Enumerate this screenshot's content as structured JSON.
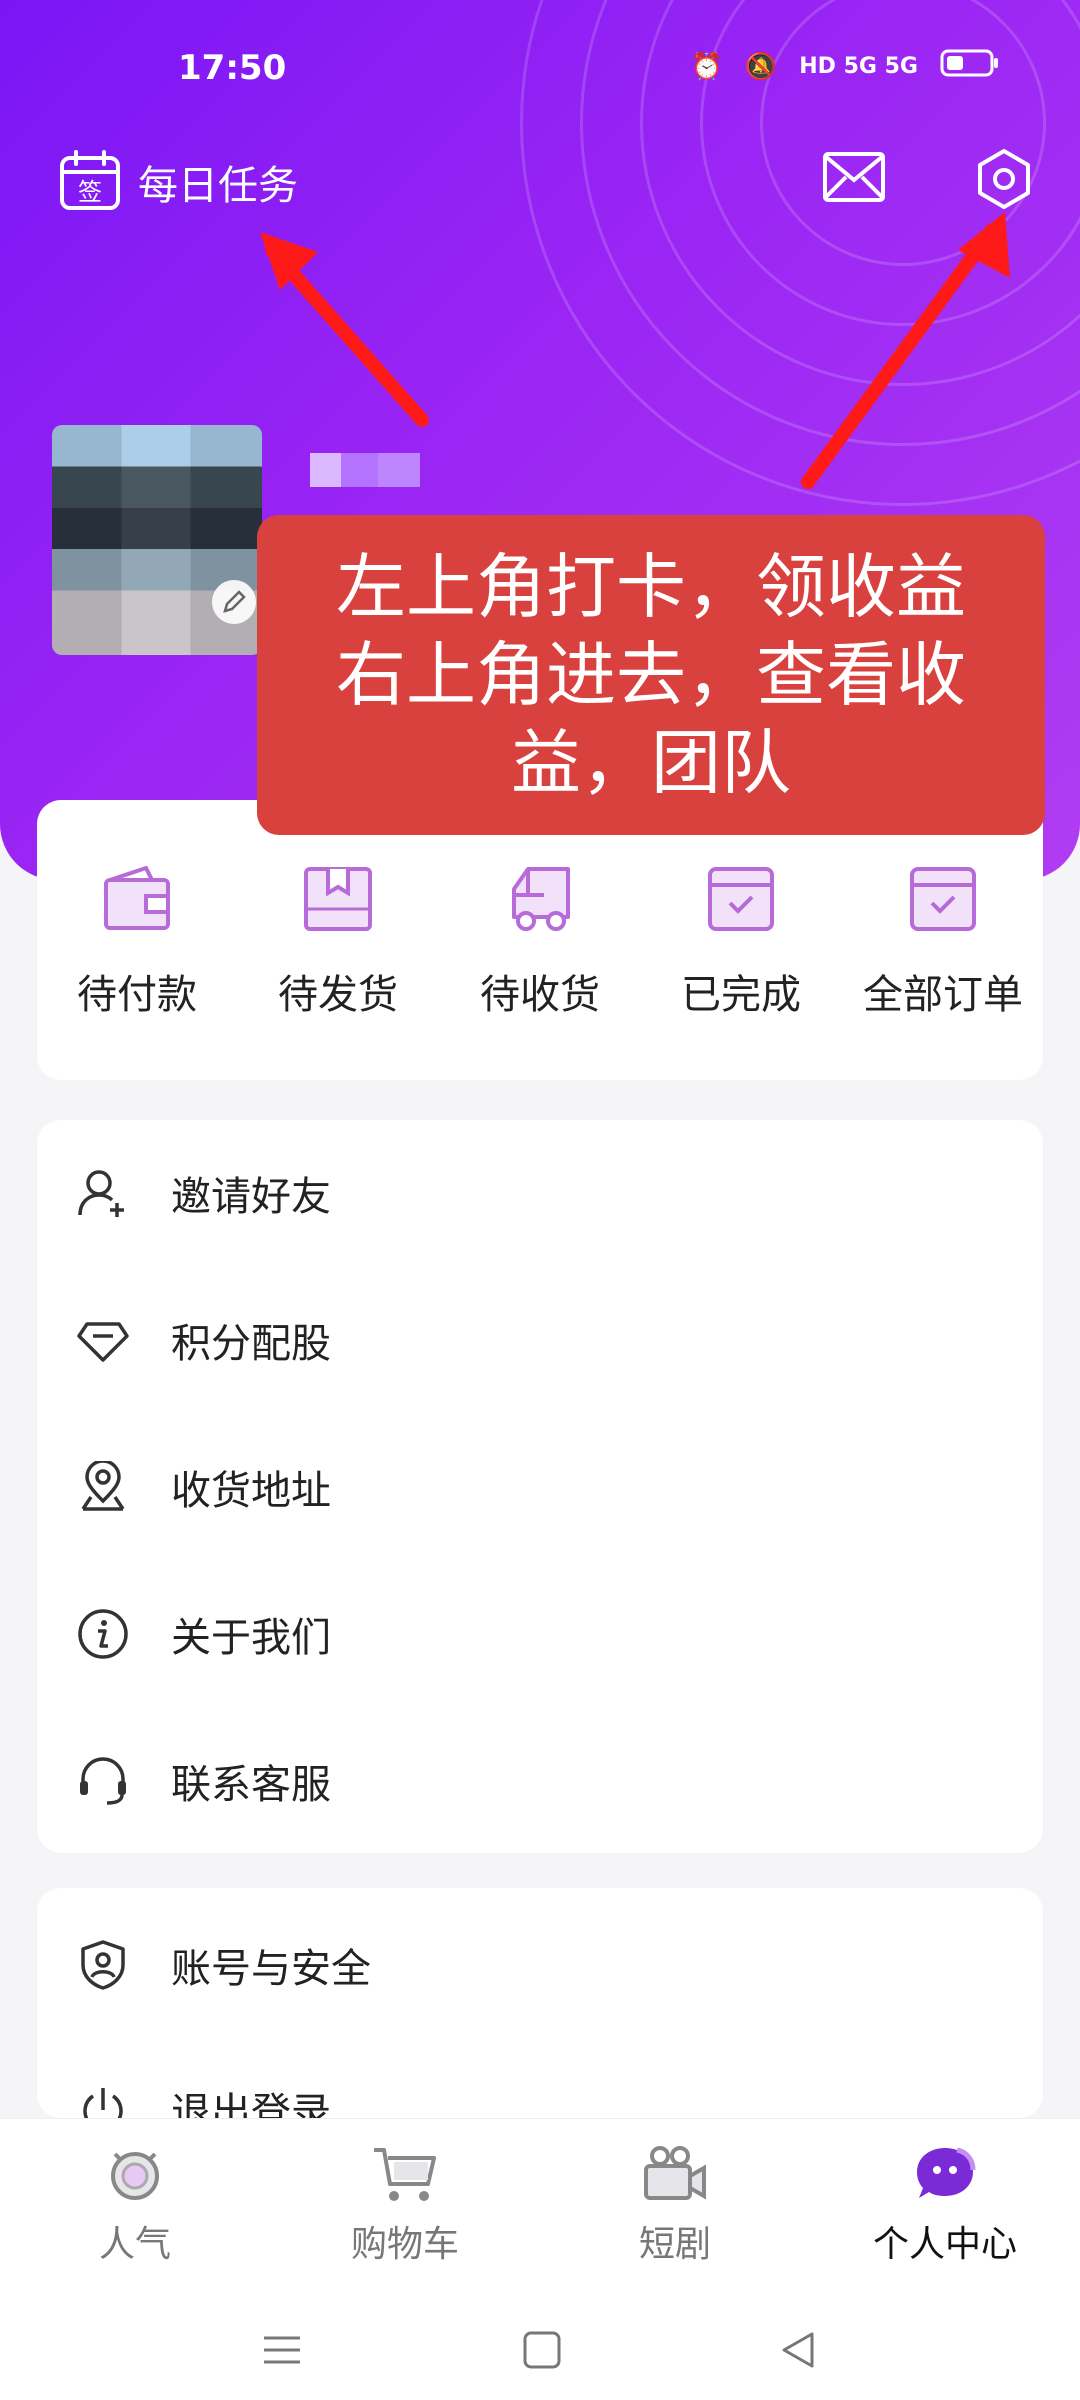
{
  "status_bar": {
    "time": "17:50",
    "network": "HD 5G 5G"
  },
  "header": {
    "daily_task_label": "每日任务",
    "daily_badge_char": "签"
  },
  "annotation": {
    "lines": [
      "左上角打卡，领收益",
      "右上角进去，查看收",
      "益，团队"
    ]
  },
  "orders": [
    {
      "label": "待付款",
      "icon": "wallet-icon"
    },
    {
      "label": "待发货",
      "icon": "package-icon"
    },
    {
      "label": "待收货",
      "icon": "delivery-truck-icon"
    },
    {
      "label": "已完成",
      "icon": "completed-box-icon"
    },
    {
      "label": "全部订单",
      "icon": "all-orders-box-icon"
    }
  ],
  "menu_group_1": [
    {
      "label": "邀请好友",
      "icon": "add-user-icon"
    },
    {
      "label": "积分配股",
      "icon": "diamond-icon"
    },
    {
      "label": "收货地址",
      "icon": "location-pin-icon"
    },
    {
      "label": "关于我们",
      "icon": "info-icon"
    },
    {
      "label": "联系客服",
      "icon": "headset-icon"
    }
  ],
  "menu_group_2": [
    {
      "label": "账号与安全",
      "icon": "shield-user-icon"
    },
    {
      "label": "退出登录",
      "icon": "power-icon"
    }
  ],
  "tabbar": [
    {
      "label": "人气",
      "icon": "popularity-icon",
      "active": false
    },
    {
      "label": "购物车",
      "icon": "cart-icon",
      "active": false
    },
    {
      "label": "短剧",
      "icon": "video-camera-icon",
      "active": false
    },
    {
      "label": "个人中心",
      "icon": "profile-chat-icon",
      "active": true
    }
  ],
  "colors": {
    "accent": "#9a25f4",
    "annotation_bg": "#d9413e",
    "icon_purple": "#b76bd9",
    "arrow_red": "#ff1a1a"
  }
}
